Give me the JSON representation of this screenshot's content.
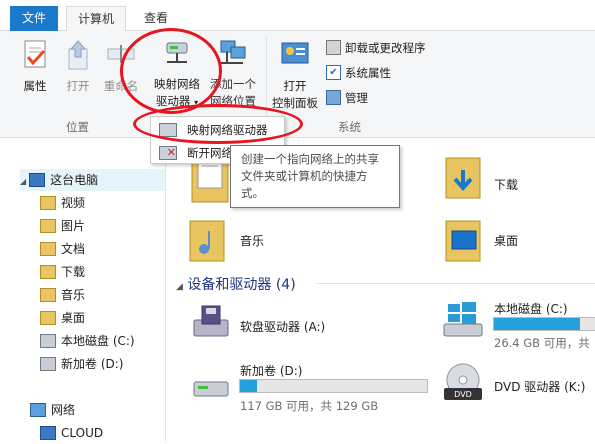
{
  "tabs": {
    "file": "文件",
    "computer": "计算机",
    "view": "查看"
  },
  "ribbon": {
    "properties": "属性",
    "open": "打开",
    "rename": "重命名",
    "map_drive_line1": "映射网络",
    "map_drive_line2": "驱动器",
    "add_location_line1": "添加一个",
    "add_location_line2": "网络位置",
    "open_cp_line1": "打开",
    "open_cp_line2": "控制面板",
    "uninstall": "卸载或更改程序",
    "sys_props": "系统属性",
    "manage": "管理",
    "group_location": "位置",
    "group_system": "系统"
  },
  "dropdown": {
    "map_drive": "映射网络驱动器",
    "disconnect": "断开网络"
  },
  "tooltip": {
    "line1": "创建一个指向网络上的共享",
    "line2": "文件夹或计算机的快捷方",
    "line3": "式。"
  },
  "nav": {
    "this_pc": "这台电脑",
    "videos": "视频",
    "pictures": "图片",
    "documents": "文档",
    "downloads": "下载",
    "music": "音乐",
    "desktop": "桌面",
    "local_c": "本地磁盘 (C:)",
    "new_d": "新加卷 (D:)",
    "network": "网络",
    "cloud": "CLOUD"
  },
  "content": {
    "downloads": "下载",
    "music": "音乐",
    "desktop": "桌面",
    "devices_header": "设备和驱动器 (4)",
    "floppy": "软盘驱动器 (A:)",
    "local_c": "本地磁盘 (C:)",
    "local_c_free": "26.4 GB 可用，共",
    "local_c_fill": 0.8,
    "new_d": "新加卷 (D:)",
    "new_d_free": "117 GB 可用，共 129 GB",
    "new_d_fill": 0.09,
    "dvd": "DVD 驱动器 (K:)",
    "dvd_badge": "DVD"
  },
  "colors": {
    "accent": "#1979ca",
    "annotation": "#e8141e",
    "bar_fill": "#26a0da"
  }
}
